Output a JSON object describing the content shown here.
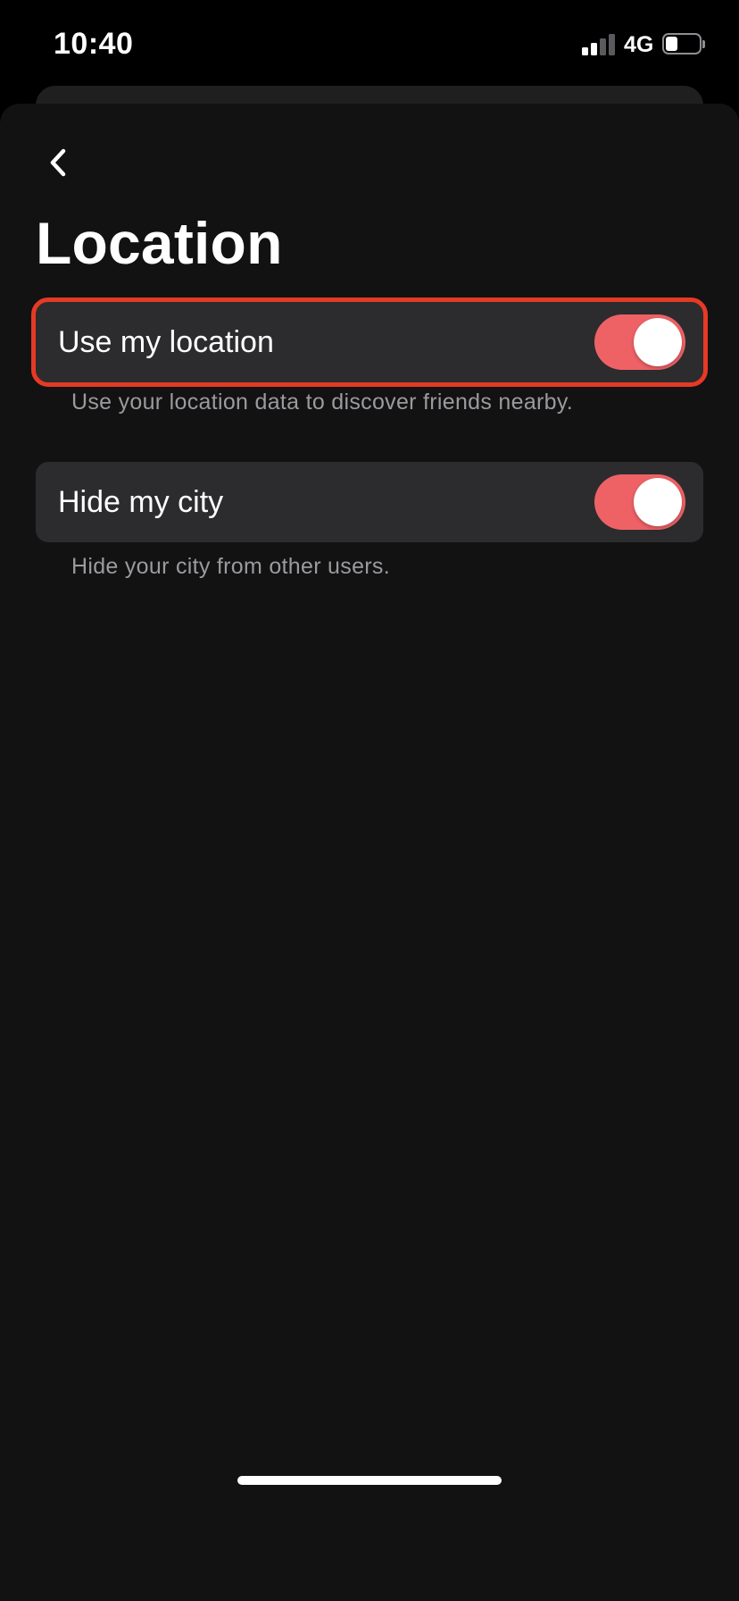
{
  "status_bar": {
    "time": "10:40",
    "network": "4G",
    "signal_bars_filled": 2,
    "signal_bars_total": 4,
    "battery_level": 0.35
  },
  "header": {
    "back_icon": "chevron-left-icon",
    "title": "Location"
  },
  "settings": [
    {
      "label": "Use my location",
      "description": "Use your location data to discover friends nearby.",
      "enabled": true
    },
    {
      "label": "Hide my city",
      "description": "Hide your city from other users.",
      "enabled": true
    }
  ],
  "colors": {
    "toggle_on": "#ee6266",
    "row_background": "#2c2c2e",
    "sheet_background": "#121212",
    "highlight_outline": "#e53a25",
    "secondary_text": "#9a9a9f"
  }
}
